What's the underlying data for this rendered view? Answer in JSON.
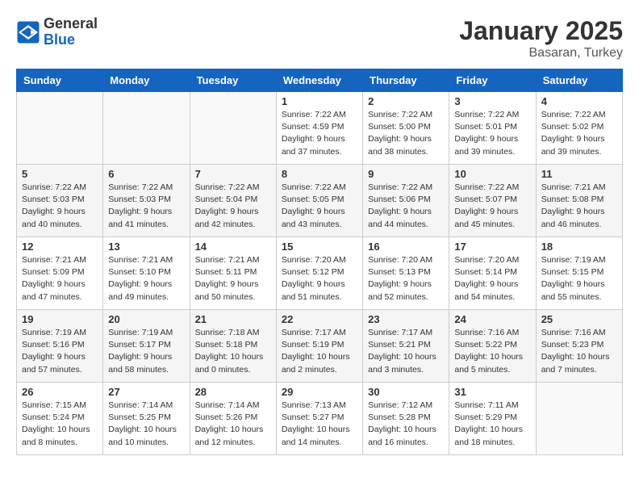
{
  "header": {
    "logo_general": "General",
    "logo_blue": "Blue",
    "month_title": "January 2025",
    "location": "Basaran, Turkey"
  },
  "days_of_week": [
    "Sunday",
    "Monday",
    "Tuesday",
    "Wednesday",
    "Thursday",
    "Friday",
    "Saturday"
  ],
  "weeks": [
    {
      "cells": [
        {
          "empty": true
        },
        {
          "empty": true
        },
        {
          "empty": true
        },
        {
          "day": 1,
          "info": "Sunrise: 7:22 AM\nSunset: 4:59 PM\nDaylight: 9 hours\nand 37 minutes."
        },
        {
          "day": 2,
          "info": "Sunrise: 7:22 AM\nSunset: 5:00 PM\nDaylight: 9 hours\nand 38 minutes."
        },
        {
          "day": 3,
          "info": "Sunrise: 7:22 AM\nSunset: 5:01 PM\nDaylight: 9 hours\nand 39 minutes."
        },
        {
          "day": 4,
          "info": "Sunrise: 7:22 AM\nSunset: 5:02 PM\nDaylight: 9 hours\nand 39 minutes."
        }
      ]
    },
    {
      "cells": [
        {
          "day": 5,
          "info": "Sunrise: 7:22 AM\nSunset: 5:03 PM\nDaylight: 9 hours\nand 40 minutes."
        },
        {
          "day": 6,
          "info": "Sunrise: 7:22 AM\nSunset: 5:03 PM\nDaylight: 9 hours\nand 41 minutes."
        },
        {
          "day": 7,
          "info": "Sunrise: 7:22 AM\nSunset: 5:04 PM\nDaylight: 9 hours\nand 42 minutes."
        },
        {
          "day": 8,
          "info": "Sunrise: 7:22 AM\nSunset: 5:05 PM\nDaylight: 9 hours\nand 43 minutes."
        },
        {
          "day": 9,
          "info": "Sunrise: 7:22 AM\nSunset: 5:06 PM\nDaylight: 9 hours\nand 44 minutes."
        },
        {
          "day": 10,
          "info": "Sunrise: 7:22 AM\nSunset: 5:07 PM\nDaylight: 9 hours\nand 45 minutes."
        },
        {
          "day": 11,
          "info": "Sunrise: 7:21 AM\nSunset: 5:08 PM\nDaylight: 9 hours\nand 46 minutes."
        }
      ]
    },
    {
      "cells": [
        {
          "day": 12,
          "info": "Sunrise: 7:21 AM\nSunset: 5:09 PM\nDaylight: 9 hours\nand 47 minutes."
        },
        {
          "day": 13,
          "info": "Sunrise: 7:21 AM\nSunset: 5:10 PM\nDaylight: 9 hours\nand 49 minutes."
        },
        {
          "day": 14,
          "info": "Sunrise: 7:21 AM\nSunset: 5:11 PM\nDaylight: 9 hours\nand 50 minutes."
        },
        {
          "day": 15,
          "info": "Sunrise: 7:20 AM\nSunset: 5:12 PM\nDaylight: 9 hours\nand 51 minutes."
        },
        {
          "day": 16,
          "info": "Sunrise: 7:20 AM\nSunset: 5:13 PM\nDaylight: 9 hours\nand 52 minutes."
        },
        {
          "day": 17,
          "info": "Sunrise: 7:20 AM\nSunset: 5:14 PM\nDaylight: 9 hours\nand 54 minutes."
        },
        {
          "day": 18,
          "info": "Sunrise: 7:19 AM\nSunset: 5:15 PM\nDaylight: 9 hours\nand 55 minutes."
        }
      ]
    },
    {
      "cells": [
        {
          "day": 19,
          "info": "Sunrise: 7:19 AM\nSunset: 5:16 PM\nDaylight: 9 hours\nand 57 minutes."
        },
        {
          "day": 20,
          "info": "Sunrise: 7:19 AM\nSunset: 5:17 PM\nDaylight: 9 hours\nand 58 minutes."
        },
        {
          "day": 21,
          "info": "Sunrise: 7:18 AM\nSunset: 5:18 PM\nDaylight: 10 hours\nand 0 minutes."
        },
        {
          "day": 22,
          "info": "Sunrise: 7:17 AM\nSunset: 5:19 PM\nDaylight: 10 hours\nand 2 minutes."
        },
        {
          "day": 23,
          "info": "Sunrise: 7:17 AM\nSunset: 5:21 PM\nDaylight: 10 hours\nand 3 minutes."
        },
        {
          "day": 24,
          "info": "Sunrise: 7:16 AM\nSunset: 5:22 PM\nDaylight: 10 hours\nand 5 minutes."
        },
        {
          "day": 25,
          "info": "Sunrise: 7:16 AM\nSunset: 5:23 PM\nDaylight: 10 hours\nand 7 minutes."
        }
      ]
    },
    {
      "cells": [
        {
          "day": 26,
          "info": "Sunrise: 7:15 AM\nSunset: 5:24 PM\nDaylight: 10 hours\nand 8 minutes."
        },
        {
          "day": 27,
          "info": "Sunrise: 7:14 AM\nSunset: 5:25 PM\nDaylight: 10 hours\nand 10 minutes."
        },
        {
          "day": 28,
          "info": "Sunrise: 7:14 AM\nSunset: 5:26 PM\nDaylight: 10 hours\nand 12 minutes."
        },
        {
          "day": 29,
          "info": "Sunrise: 7:13 AM\nSunset: 5:27 PM\nDaylight: 10 hours\nand 14 minutes."
        },
        {
          "day": 30,
          "info": "Sunrise: 7:12 AM\nSunset: 5:28 PM\nDaylight: 10 hours\nand 16 minutes."
        },
        {
          "day": 31,
          "info": "Sunrise: 7:11 AM\nSunset: 5:29 PM\nDaylight: 10 hours\nand 18 minutes."
        },
        {
          "empty": true
        }
      ]
    }
  ]
}
